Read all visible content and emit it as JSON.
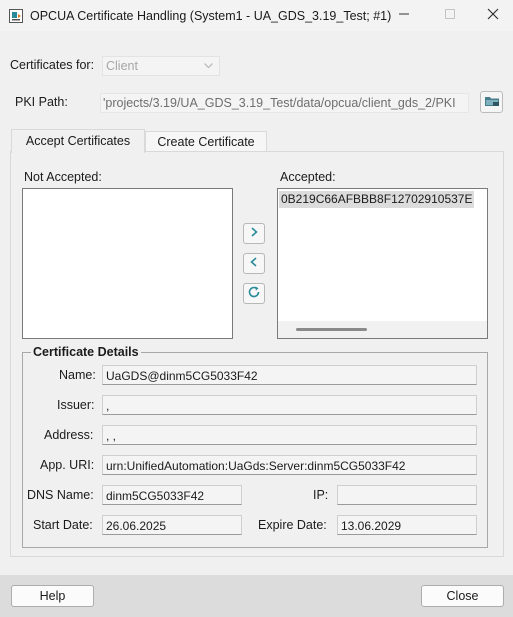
{
  "window": {
    "title": "OPCUA Certificate Handling (System1 - UA_GDS_3.19_Test; #1)",
    "app_icon": "certificate-app-icon",
    "controls": {
      "minimize": "minimize-icon",
      "maximize": "maximize-icon",
      "close": "close-icon"
    }
  },
  "form": {
    "certificates_for_label": "Certificates for:",
    "certificates_for_value": "Client",
    "pki_path_label": "PKI Path:",
    "pki_path_value": "'projects/3.19/UA_GDS_3.19_Test/data/opcua/client_gds_2/PKI",
    "browse_icon": "folder-browse-icon"
  },
  "tabs": [
    {
      "label": "Accept Certificates",
      "active": true
    },
    {
      "label": "Create Certificate",
      "active": false
    }
  ],
  "lists": {
    "not_accepted_label": "Not Accepted:",
    "not_accepted_items": [],
    "accepted_label": "Accepted:",
    "accepted_items": [
      "0B219C66AFBBB8F12702910537E"
    ]
  },
  "move_buttons": {
    "accept": "chevron-right-icon",
    "reject": "chevron-left-icon",
    "refresh": "refresh-icon"
  },
  "details": {
    "title": "Certificate Details",
    "name_label": "Name:",
    "name_value": "UaGDS@dinm5CG5033F42",
    "issuer_label": "Issuer:",
    "issuer_value": ",",
    "address_label": "Address:",
    "address_value": ", ,",
    "app_uri_label": "App. URI:",
    "app_uri_value": "urn:UnifiedAutomation:UaGds:Server:dinm5CG5033F42",
    "dns_label": "DNS Name:",
    "dns_value": "dinm5CG5033F42",
    "ip_label": "IP:",
    "ip_value": "",
    "start_label": "Start Date:",
    "start_value": "26.06.2025",
    "expire_label": "Expire Date:",
    "expire_value": "13.06.2029"
  },
  "footer": {
    "help_label": "Help",
    "close_label": "Close"
  },
  "colors": {
    "accent": "#2a8a9a",
    "selection": "#dcdcdc",
    "bottom_bar": "#dcdcdc"
  }
}
